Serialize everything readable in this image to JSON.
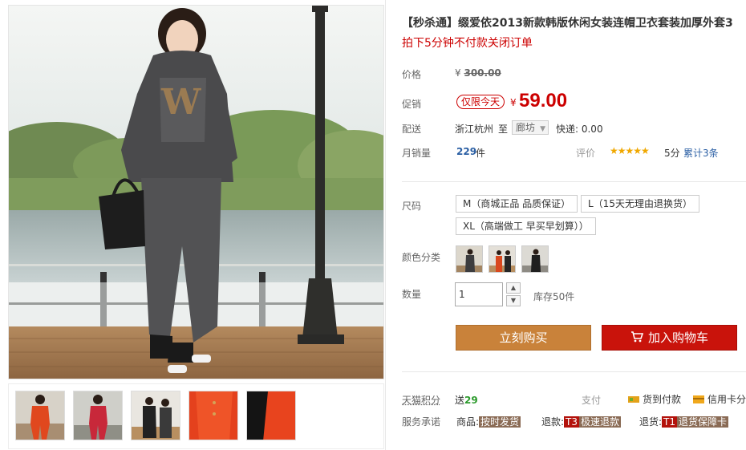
{
  "product": {
    "title": "【秒杀通】缀爱依2013新款韩版休闲女装连帽卫衣套装加厚外套3",
    "subtitle": "拍下5分钟不付款关闭订单"
  },
  "price": {
    "label": "价格",
    "currency": "¥",
    "original": "300.00"
  },
  "promo": {
    "label": "促销",
    "badge": "仅限今天",
    "currency": "¥",
    "price": "59.00"
  },
  "shipping": {
    "label": "配送",
    "from": "浙江杭州",
    "to_label": "至",
    "to_value": "廊坊",
    "express": "快递: 0.00"
  },
  "sales": {
    "label": "月销量",
    "count": "229",
    "unit": "件",
    "rating_label": "评价",
    "stars": "★★★★★",
    "score": "5分",
    "reviews": "累计3条"
  },
  "size": {
    "label": "尺码",
    "options": [
      "M（商城正品 品质保证）",
      "L（15天无理由退换货）",
      "XL（高端做工 早买早划算））"
    ]
  },
  "color": {
    "label": "颜色分类"
  },
  "quantity": {
    "label": "数量",
    "value": "1",
    "stock": "库存50件"
  },
  "actions": {
    "buy_now": "立刻购买",
    "add_cart": "加入购物车"
  },
  "points": {
    "label": "天猫积分",
    "give_prefix": "送",
    "give_value": "29"
  },
  "payment": {
    "label": "支付",
    "cod": "货到付款",
    "card": "信用卡分"
  },
  "service": {
    "label": "服务承诺",
    "goods_prefix": "商品:",
    "goods_tag": "按时发货",
    "refund_prefix": "退款:",
    "refund_code": "T3",
    "refund_tag": "极速退款",
    "return_prefix": "退货:",
    "return_code": "T1",
    "return_tag": "退货保障卡"
  },
  "colors": {
    "accent_red": "#c00000",
    "buy_now_bg": "#c9823a",
    "add_cart_bg": "#c9130b",
    "star": "#f0a800",
    "link_blue": "#2b5fa4"
  }
}
